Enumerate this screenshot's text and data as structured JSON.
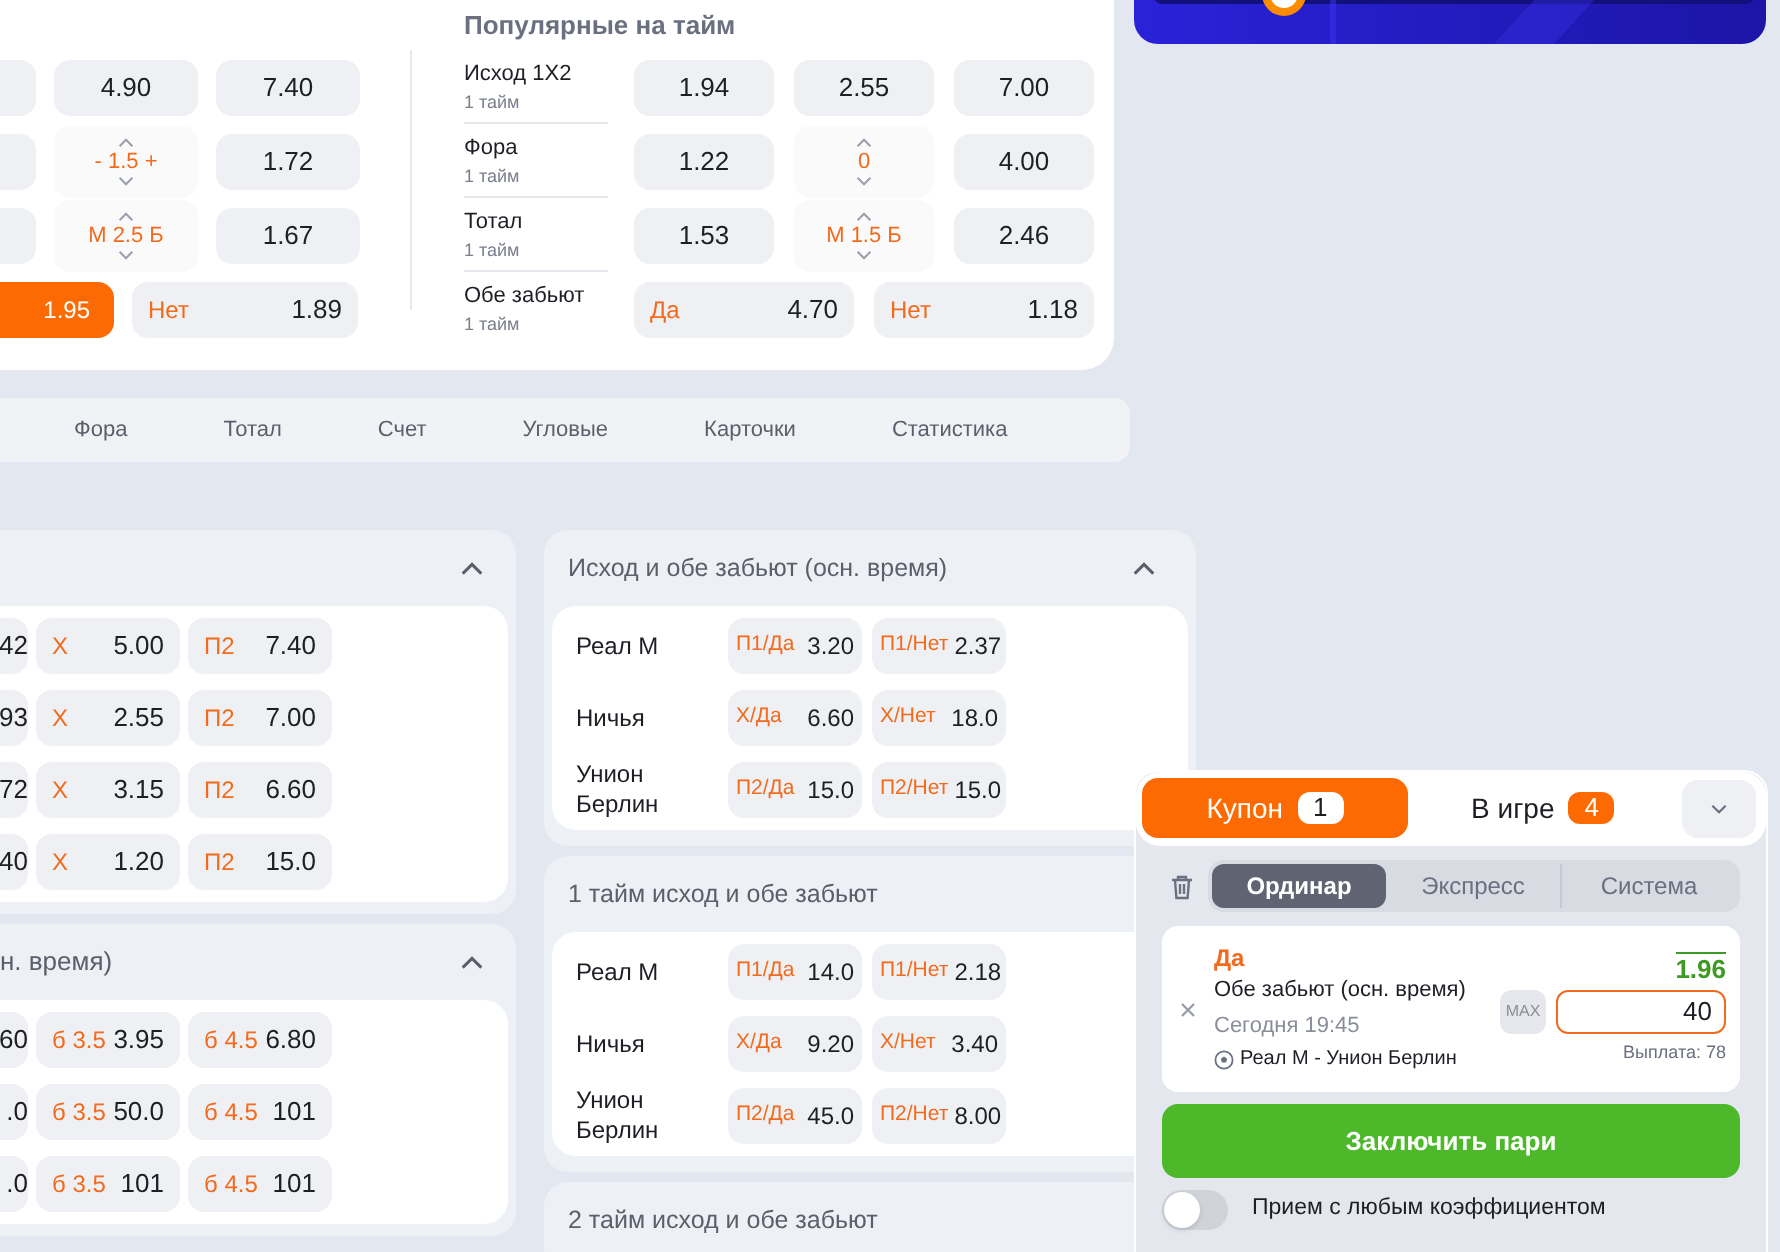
{
  "top_card": {
    "left_rows": [
      {
        "cells": [
          {
            "kind": "stub"
          },
          {
            "kind": "odd",
            "value": "4.90",
            "selected": false
          },
          {
            "kind": "odd",
            "value": "7.40",
            "selected": false
          }
        ]
      },
      {
        "cells": [
          {
            "kind": "stub"
          },
          {
            "kind": "line",
            "text": "- 1.5 +"
          },
          {
            "kind": "odd",
            "value": "1.72",
            "selected": false
          }
        ]
      },
      {
        "cells": [
          {
            "kind": "stub"
          },
          {
            "kind": "line",
            "text": "М 2.5 Б"
          },
          {
            "kind": "odd",
            "value": "1.67",
            "selected": false
          }
        ]
      },
      {
        "cells": [
          {
            "kind": "odd",
            "value": "1.95",
            "selected": true
          },
          {
            "kind": "odd",
            "label": "Нет",
            "value": "1.89",
            "selected": false
          }
        ]
      }
    ],
    "title": "Популярные на тайм",
    "rows": [
      {
        "name": "Исход 1X2",
        "sub": "1 тайм",
        "cells": [
          {
            "kind": "odd",
            "value": "1.94",
            "selected": false
          },
          {
            "kind": "odd",
            "value": "2.55",
            "selected": false
          },
          {
            "kind": "odd",
            "value": "7.00",
            "selected": false
          }
        ]
      },
      {
        "name": "Фора",
        "sub": "1 тайм",
        "cells": [
          {
            "kind": "odd",
            "value": "1.22",
            "selected": false
          },
          {
            "kind": "line",
            "text": "0"
          },
          {
            "kind": "odd",
            "value": "4.00",
            "selected": false
          }
        ]
      },
      {
        "name": "Тотал",
        "sub": "1 тайм",
        "cells": [
          {
            "kind": "odd",
            "value": "1.53",
            "selected": false
          },
          {
            "kind": "line",
            "text": "М 1.5 Б"
          },
          {
            "kind": "odd",
            "value": "2.46",
            "selected": false
          }
        ]
      },
      {
        "name": "Обе забьют",
        "sub": "1 тайм",
        "cells": [
          {
            "kind": "odd",
            "label": "Да",
            "value": "4.70",
            "selected": false
          },
          {
            "kind": "odd",
            "label": "Нет",
            "value": "1.18",
            "selected": false
          }
        ]
      }
    ]
  },
  "tabs": [
    {
      "label": "Фора",
      "selected": false
    },
    {
      "label": "Тотал",
      "selected": false
    },
    {
      "label": "Счет",
      "selected": false
    },
    {
      "label": "Угловые",
      "selected": false
    },
    {
      "label": "Карточки",
      "selected": false
    },
    {
      "label": "Статистика",
      "selected": false
    }
  ],
  "left_panels": [
    {
      "expanded": true,
      "rows": [
        {
          "cells": [
            {
              "kind": "stub",
              "text": "42"
            },
            {
              "kind": "odd",
              "label": "X",
              "value": "5.00",
              "selected": false
            },
            {
              "kind": "odd",
              "label": "П2",
              "value": "7.40",
              "selected": false
            }
          ]
        },
        {
          "cells": [
            {
              "kind": "stub",
              "text": "93"
            },
            {
              "kind": "odd",
              "label": "X",
              "value": "2.55",
              "selected": false
            },
            {
              "kind": "odd",
              "label": "П2",
              "value": "7.00",
              "selected": false
            }
          ]
        },
        {
          "cells": [
            {
              "kind": "stub",
              "text": "72"
            },
            {
              "kind": "odd",
              "label": "X",
              "value": "3.15",
              "selected": false
            },
            {
              "kind": "odd",
              "label": "П2",
              "value": "6.60",
              "selected": false
            }
          ]
        },
        {
          "cells": [
            {
              "kind": "stub",
              "text": "40"
            },
            {
              "kind": "odd",
              "label": "X",
              "value": "1.20",
              "selected": false
            },
            {
              "kind": "odd",
              "label": "П2",
              "value": "15.0",
              "selected": false
            }
          ]
        }
      ]
    },
    {
      "title": "н. время)",
      "expanded": true,
      "rows": [
        {
          "cells": [
            {
              "kind": "stub",
              "text": "60"
            },
            {
              "kind": "odd",
              "label": "б 3.5",
              "value": "3.95",
              "selected": false
            },
            {
              "kind": "odd",
              "label": "б 4.5",
              "value": "6.80",
              "selected": false
            }
          ]
        },
        {
          "cells": [
            {
              "kind": "stub",
              "text": ".0"
            },
            {
              "kind": "odd",
              "label": "б 3.5",
              "value": "50.0",
              "selected": false
            },
            {
              "kind": "odd",
              "label": "б 4.5",
              "value": "101",
              "selected": false
            }
          ]
        },
        {
          "cells": [
            {
              "kind": "stub",
              "text": ".0"
            },
            {
              "kind": "odd",
              "label": "б 3.5",
              "value": "101",
              "selected": false
            },
            {
              "kind": "odd",
              "label": "б 4.5",
              "value": "101",
              "selected": false
            }
          ]
        }
      ]
    }
  ],
  "middle_panels": [
    {
      "title": "Исход и обе забьют (осн. время)",
      "expanded": true,
      "rows": [
        {
          "name": "Реал М",
          "cells": [
            {
              "kind": "odd",
              "label": "П1/Да",
              "value": "3.20",
              "selected": false
            },
            {
              "kind": "odd",
              "label": "П1/Нет",
              "value": "2.37",
              "selected": false
            }
          ]
        },
        {
          "name": "Ничья",
          "cells": [
            {
              "kind": "odd",
              "label": "Х/Да",
              "value": "6.60",
              "selected": false
            },
            {
              "kind": "odd",
              "label": "Х/Нет",
              "value": "18.0",
              "selected": false
            }
          ]
        },
        {
          "name": "Унион Берлин",
          "cells": [
            {
              "kind": "odd",
              "label": "П2/Да",
              "value": "15.0",
              "selected": false
            },
            {
              "kind": "odd",
              "label": "П2/Нет",
              "value": "15.0",
              "selected": false
            }
          ]
        }
      ]
    },
    {
      "title": "1 тайм исход и обе забьют",
      "rows": [
        {
          "name": "Реал М",
          "cells": [
            {
              "kind": "odd",
              "label": "П1/Да",
              "value": "14.0",
              "selected": false
            },
            {
              "kind": "odd",
              "label": "П1/Нет",
              "value": "2.18",
              "selected": false
            }
          ]
        },
        {
          "name": "Ничья",
          "cells": [
            {
              "kind": "odd",
              "label": "Х/Да",
              "value": "9.20",
              "selected": false
            },
            {
              "kind": "odd",
              "label": "Х/Нет",
              "value": "3.40",
              "selected": false
            }
          ]
        },
        {
          "name": "Унион Берлин",
          "cells": [
            {
              "kind": "odd",
              "label": "П2/Да",
              "value": "45.0",
              "selected": false
            },
            {
              "kind": "odd",
              "label": "П2/Нет",
              "value": "8.00",
              "selected": false
            }
          ]
        }
      ]
    },
    {
      "title": "2 тайм исход и обе забьют"
    }
  ],
  "coupon": {
    "tabs": [
      {
        "label": "Купон",
        "count": "1",
        "selected": true
      },
      {
        "label": "В игре",
        "count": "4",
        "selected": false
      }
    ],
    "bet_types": [
      {
        "label": "Ординар",
        "selected": true
      },
      {
        "label": "Экспресс",
        "selected": false
      },
      {
        "label": "Система",
        "selected": false
      }
    ],
    "bet": {
      "pick": "Да",
      "odds": "1.96",
      "market": "Обе забьют (осн. время)",
      "time": "Сегодня 19:45",
      "match": "Реал М - Унион Берлин",
      "max": "MAX",
      "stake": "40",
      "payout": "Выплата: 78"
    },
    "submit": "Заключить пари",
    "accept_any": {
      "label": "Прием с любым коэффициентом",
      "on": false
    }
  }
}
